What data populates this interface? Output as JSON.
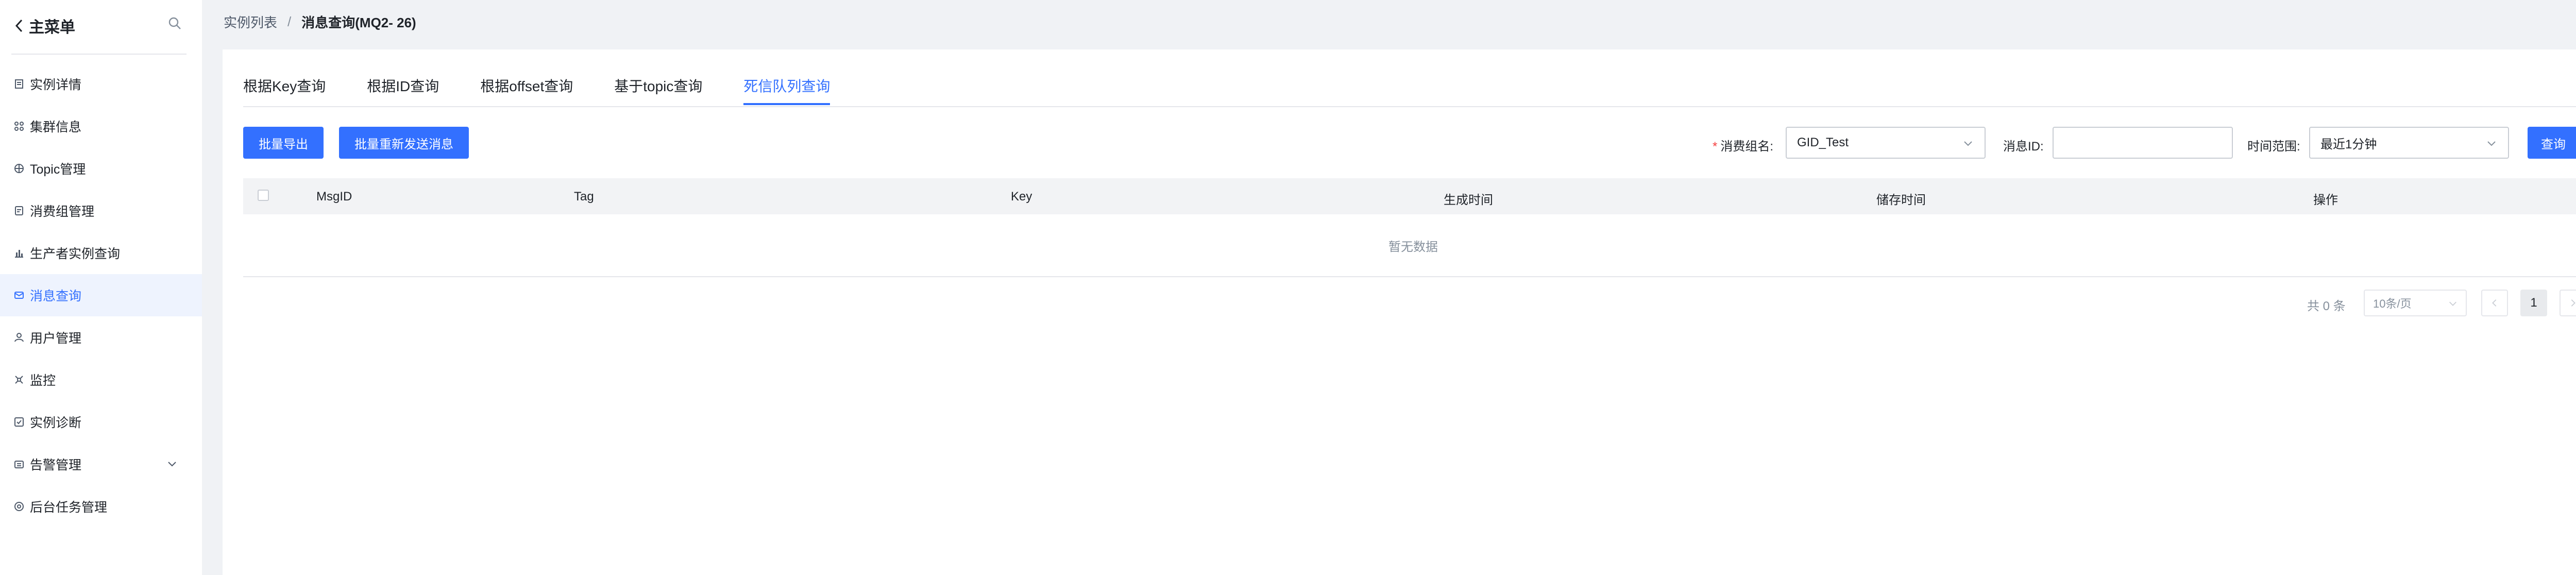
{
  "sidebar": {
    "back_label": "主菜单",
    "items": [
      {
        "label": "实例详情",
        "icon": "file-icon"
      },
      {
        "label": "集群信息",
        "icon": "cluster-icon"
      },
      {
        "label": "Topic管理",
        "icon": "grid-icon"
      },
      {
        "label": "消费组管理",
        "icon": "document-icon"
      },
      {
        "label": "生产者实例查询",
        "icon": "bar-chart-icon"
      },
      {
        "label": "消息查询",
        "icon": "message-icon",
        "active": true
      },
      {
        "label": "用户管理",
        "icon": "user-icon"
      },
      {
        "label": "监控",
        "icon": "monitor-icon"
      },
      {
        "label": "实例诊断",
        "icon": "diagnose-icon"
      },
      {
        "label": "告警管理",
        "icon": "alarm-icon",
        "expandable": true
      },
      {
        "label": "后台任务管理",
        "icon": "task-icon"
      }
    ]
  },
  "breadcrumb": {
    "parent": "实例列表",
    "separator": "/",
    "current": "消息查询(MQ2-          26)"
  },
  "tabs": [
    {
      "label": "根据Key查询"
    },
    {
      "label": "根据ID查询"
    },
    {
      "label": "根据offset查询"
    },
    {
      "label": "基于topic查询"
    },
    {
      "label": "死信队列查询",
      "active": true
    }
  ],
  "toolbar": {
    "export_label": "批量导出",
    "resend_label": "批量重新发送消息",
    "consumer_group_label": "消费组名:",
    "consumer_group_value": "GID_Test",
    "message_id_label": "消息ID:",
    "message_id_value": "",
    "time_range_label": "时间范围:",
    "time_range_value": "最近1分钟",
    "query_label": "查询"
  },
  "table": {
    "columns": [
      "MsgID",
      "Tag",
      "Key",
      "生成时间",
      "储存时间",
      "操作"
    ],
    "empty_text": "暂无数据"
  },
  "pagination": {
    "total_text": "共 0 条",
    "page_size": "10条/页",
    "current_page": "1"
  },
  "colors": {
    "primary": "#3370ff",
    "active_bg": "#eef3fe",
    "required": "#f53f3f"
  }
}
